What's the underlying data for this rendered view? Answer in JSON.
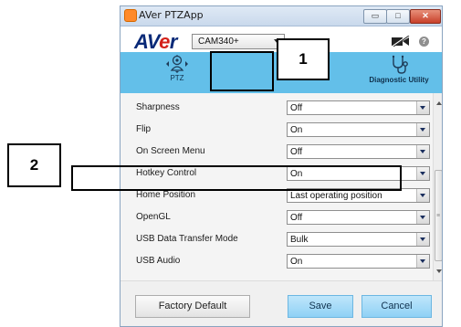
{
  "window": {
    "title": "AVer PTZApp",
    "controls": {
      "minimize": "▭",
      "maximize": "□",
      "close": "✕"
    }
  },
  "header": {
    "logo": {
      "part1": "AV",
      "part2": "e",
      "part3": "r"
    },
    "camera_model": "CAM340+",
    "help_icon": "?"
  },
  "tabs": [
    {
      "label": "PTZ"
    },
    {
      "label": "Diagnostic Utility"
    }
  ],
  "settings": [
    {
      "label": "Sharpness",
      "value": "Off"
    },
    {
      "label": "Flip",
      "value": "On"
    },
    {
      "label": "On Screen Menu",
      "value": "Off"
    },
    {
      "label": "Hotkey Control",
      "value": "On"
    },
    {
      "label": "Home Position",
      "value": "Last operating position"
    },
    {
      "label": "OpenGL",
      "value": "Off"
    },
    {
      "label": "USB Data Transfer Mode",
      "value": "Bulk"
    },
    {
      "label": "USB Audio",
      "value": "On"
    }
  ],
  "scrollbar": {
    "grip": "≡"
  },
  "footer": {
    "factory_default": "Factory Default",
    "save": "Save",
    "cancel": "Cancel"
  },
  "annotations": [
    {
      "number": "1"
    },
    {
      "number": "2"
    }
  ],
  "colors": {
    "tabbar": "#63bfe9",
    "primary_button": "#8fd1f5",
    "logo_blue": "#0a2a78",
    "logo_red": "#d3201a"
  }
}
